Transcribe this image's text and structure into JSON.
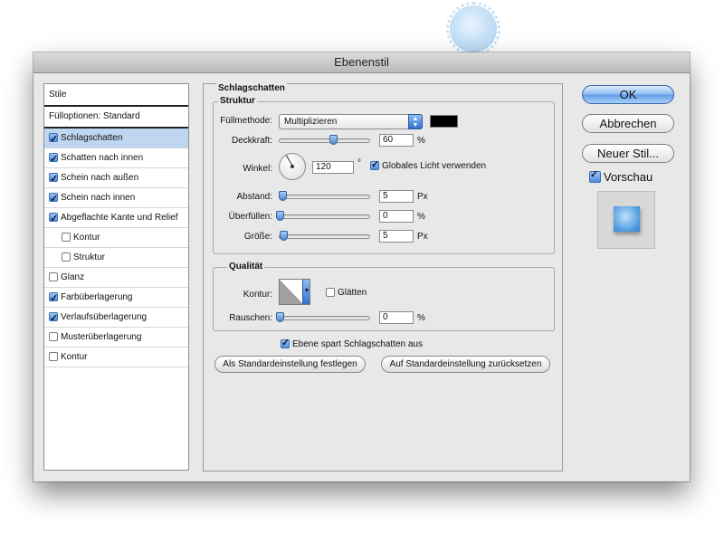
{
  "window": {
    "title": "Ebenenstil"
  },
  "style_list": {
    "header": "Stile",
    "items": [
      {
        "label": "Fülloptionen: Standard",
        "checkbox": false,
        "checked": false,
        "indent": false,
        "selected": false
      },
      {
        "label": "Schlagschatten",
        "checkbox": true,
        "checked": true,
        "indent": false,
        "selected": true
      },
      {
        "label": "Schatten nach innen",
        "checkbox": true,
        "checked": true,
        "indent": false,
        "selected": false
      },
      {
        "label": "Schein nach außen",
        "checkbox": true,
        "checked": true,
        "indent": false,
        "selected": false
      },
      {
        "label": "Schein nach innen",
        "checkbox": true,
        "checked": true,
        "indent": false,
        "selected": false
      },
      {
        "label": "Abgeflachte Kante und Relief",
        "checkbox": true,
        "checked": true,
        "indent": false,
        "selected": false
      },
      {
        "label": "Kontur",
        "checkbox": true,
        "checked": false,
        "indent": true,
        "selected": false
      },
      {
        "label": "Struktur",
        "checkbox": true,
        "checked": false,
        "indent": true,
        "selected": false
      },
      {
        "label": "Glanz",
        "checkbox": true,
        "checked": false,
        "indent": false,
        "selected": false
      },
      {
        "label": "Farbüberlagerung",
        "checkbox": true,
        "checked": true,
        "indent": false,
        "selected": false
      },
      {
        "label": "Verlaufsüberlagerung",
        "checkbox": true,
        "checked": true,
        "indent": false,
        "selected": false
      },
      {
        "label": "Musterüberlagerung",
        "checkbox": true,
        "checked": false,
        "indent": false,
        "selected": false
      },
      {
        "label": "Kontur",
        "checkbox": true,
        "checked": false,
        "indent": false,
        "selected": false
      }
    ]
  },
  "drop_shadow": {
    "section_title": "Schlagschatten",
    "structure": {
      "title": "Struktur",
      "blend_mode_label": "Füllmethode:",
      "blend_mode_value": "Multiplizieren",
      "blend_color": "#000000",
      "opacity_label": "Deckkraft:",
      "opacity_value": "60",
      "opacity_unit": "%",
      "opacity_fraction": 0.6,
      "angle_label": "Winkel:",
      "angle_value": "120",
      "angle_unit": "°",
      "global_light_label": "Globales Licht verwenden",
      "global_light_checked": true,
      "distance_label": "Abstand:",
      "distance_value": "5",
      "distance_unit": "Px",
      "spread_label": "Überfüllen:",
      "spread_value": "0",
      "spread_unit": "%",
      "size_label": "Größe:",
      "size_value": "5",
      "size_unit": "Px"
    },
    "quality": {
      "title": "Qualität",
      "contour_label": "Kontur:",
      "antialias_label": "Glätten",
      "antialias_checked": false,
      "noise_label": "Rauschen:",
      "noise_value": "0",
      "noise_unit": "%"
    },
    "knockout_label": "Ebene spart Schlagschatten aus",
    "knockout_checked": true,
    "make_default_label": "Als Standardeinstellung festlegen",
    "reset_default_label": "Auf Standardeinstellung zurücksetzen"
  },
  "actions": {
    "ok_label": "OK",
    "cancel_label": "Abbrechen",
    "new_style_label": "Neuer Stil...",
    "preview_label": "Vorschau",
    "preview_checked": true
  }
}
